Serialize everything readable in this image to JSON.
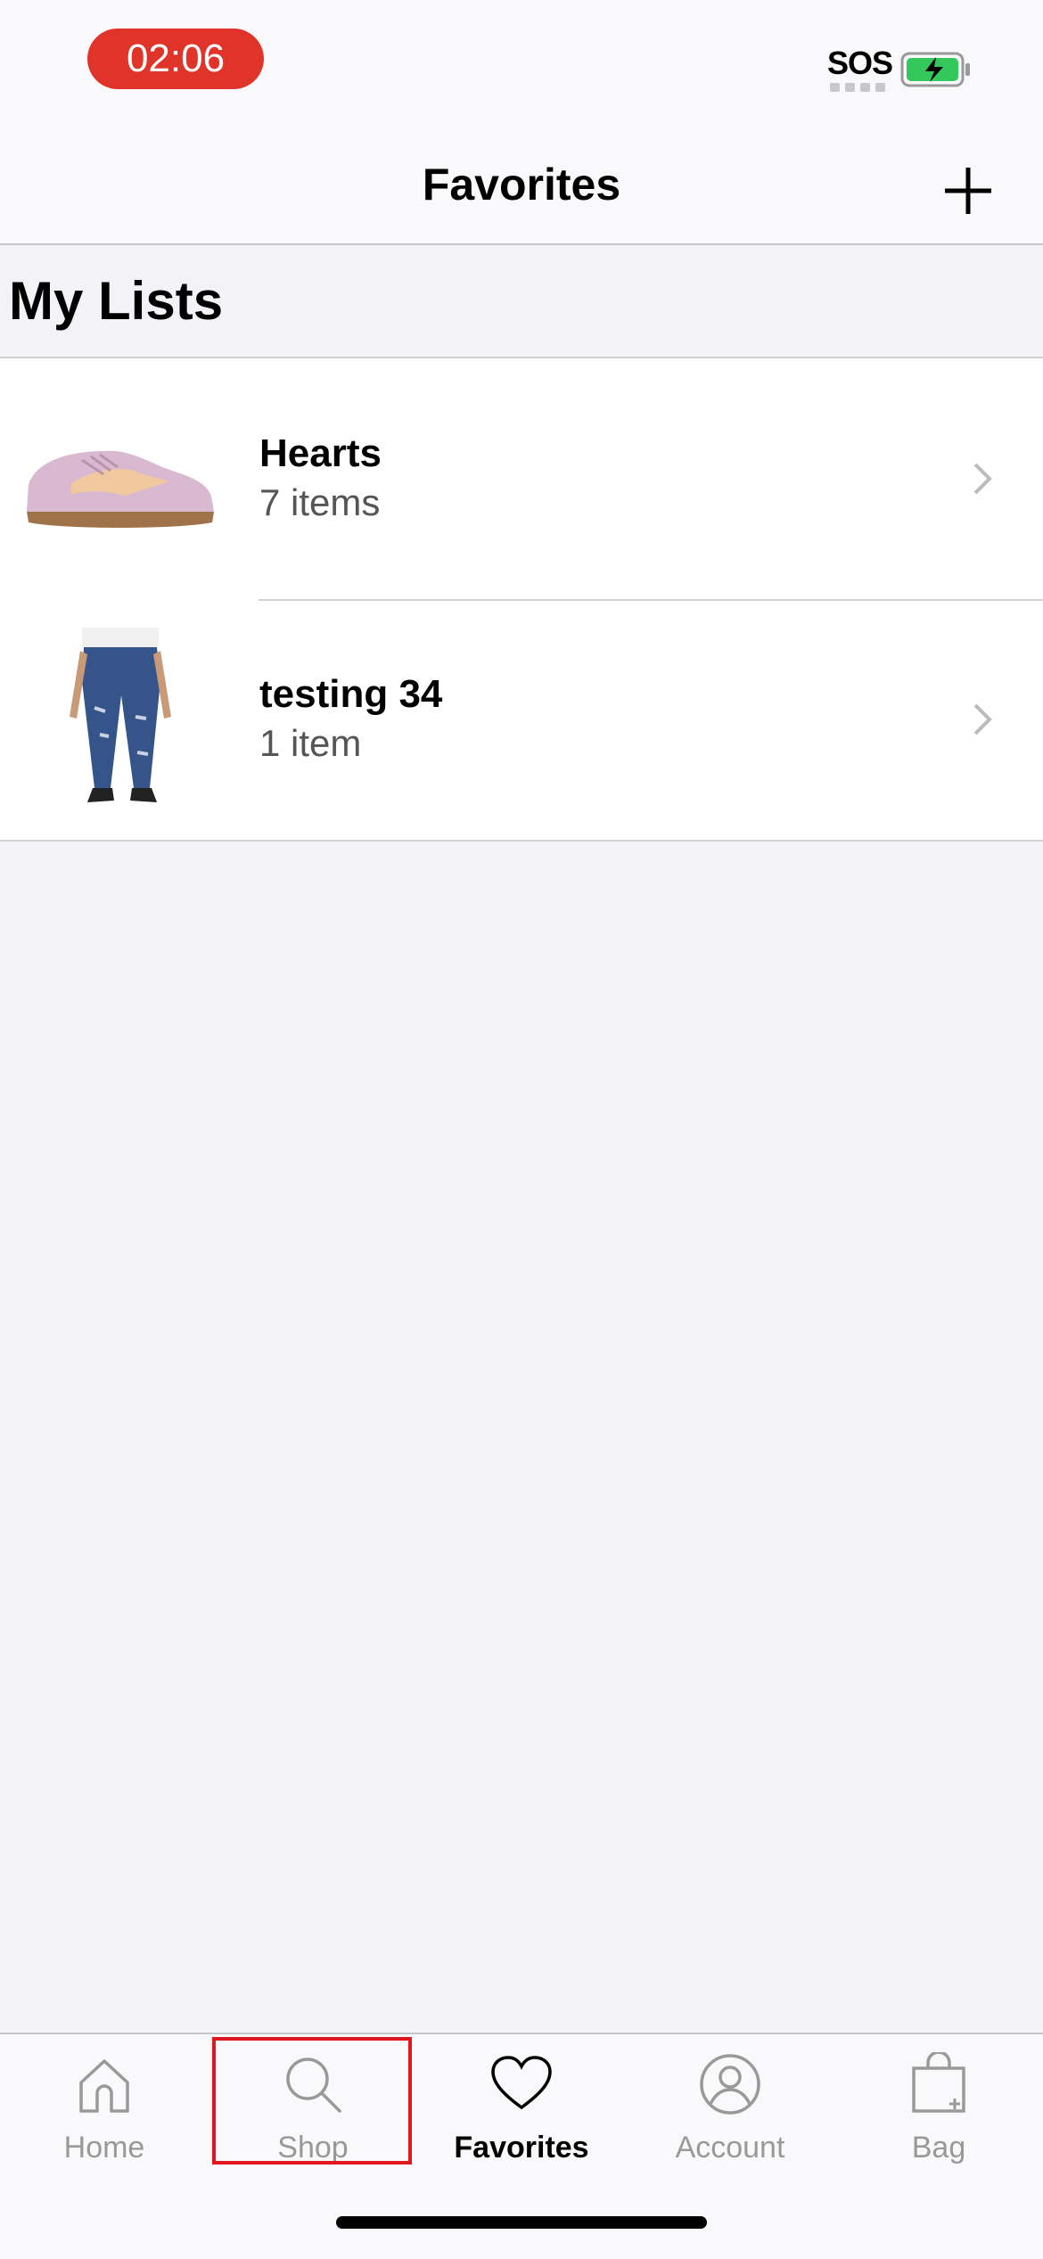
{
  "status_bar": {
    "time": "02:06",
    "sos": "SOS",
    "battery_state": "charging"
  },
  "nav": {
    "title": "Favorites",
    "add_icon": "plus-icon"
  },
  "section": {
    "title": "My Lists"
  },
  "lists": [
    {
      "title": "Hearts",
      "count": "7 items",
      "thumbnail": "pink-sneaker"
    },
    {
      "title": "testing 34",
      "count": "1 item",
      "thumbnail": "ripped-jeans"
    }
  ],
  "tabs": [
    {
      "label": "Home",
      "icon": "house-icon",
      "active": false
    },
    {
      "label": "Shop",
      "icon": "search-icon",
      "active": false,
      "highlighted": true
    },
    {
      "label": "Favorites",
      "icon": "heart-icon",
      "active": true
    },
    {
      "label": "Account",
      "icon": "user-circle-icon",
      "active": false
    },
    {
      "label": "Bag",
      "icon": "shopping-bag-icon",
      "active": false
    }
  ],
  "colors": {
    "time_pill": "#e0342a",
    "battery": "#34c759",
    "highlight": "#e0171c"
  }
}
